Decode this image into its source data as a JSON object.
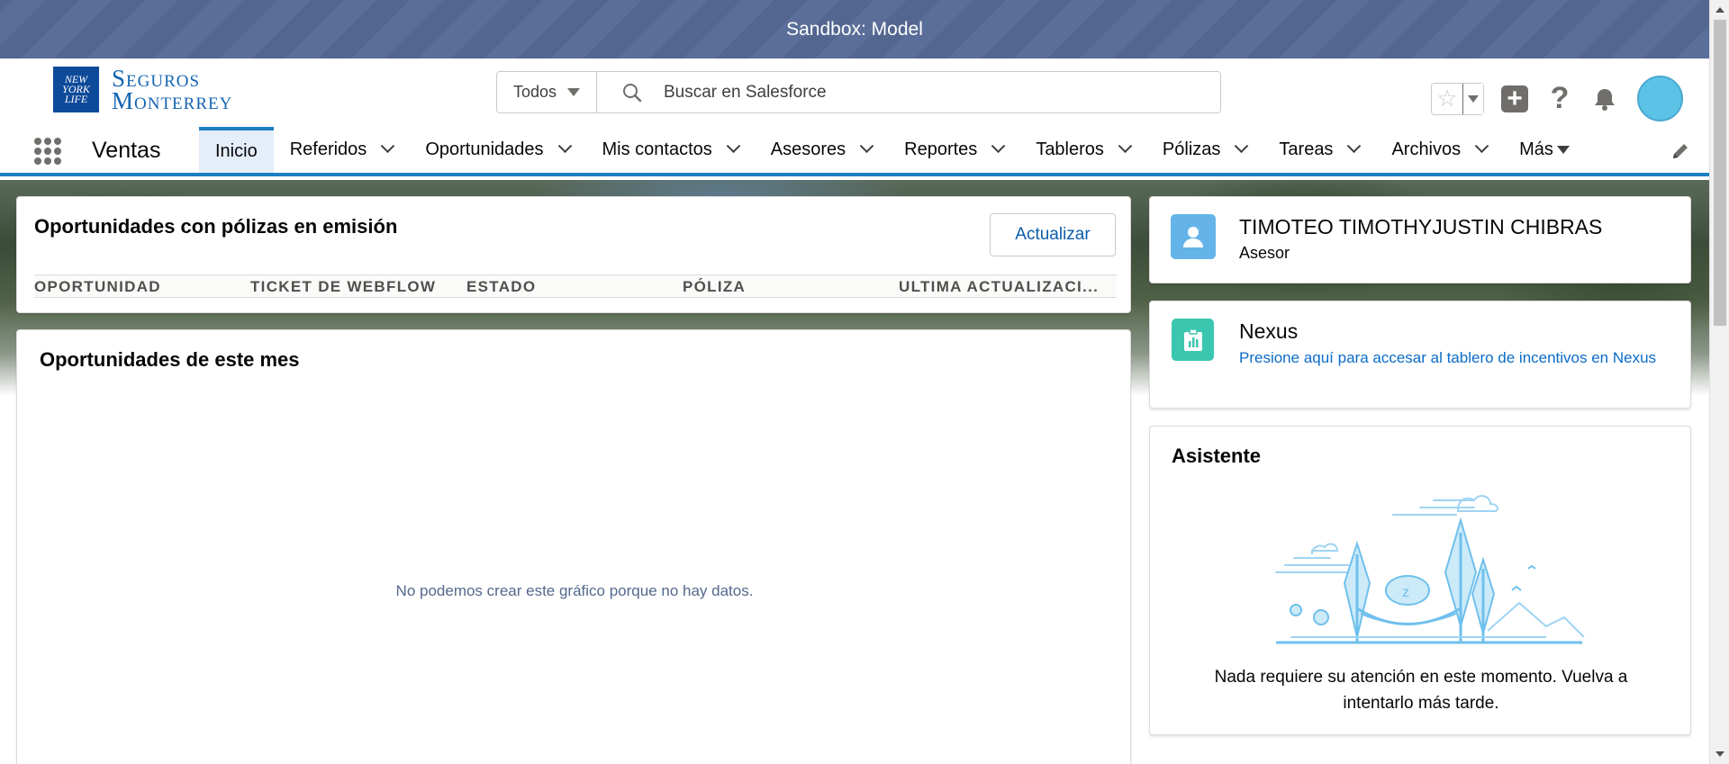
{
  "sandbox_banner": "Sandbox: Model",
  "logo": {
    "badge_lines": [
      "NEW",
      "YORK",
      "LIFE"
    ],
    "name_line1": "Seguros",
    "name_line2": "Monterrey"
  },
  "search": {
    "scope": "Todos",
    "placeholder": "Buscar en Salesforce"
  },
  "nav": {
    "app_name": "Ventas",
    "tabs": [
      {
        "label": "Inicio",
        "active": true
      },
      {
        "label": "Referidos"
      },
      {
        "label": "Oportunidades"
      },
      {
        "label": "Mis contactos"
      },
      {
        "label": "Asesores"
      },
      {
        "label": "Reportes"
      },
      {
        "label": "Tableros"
      },
      {
        "label": "Pólizas"
      },
      {
        "label": "Tareas"
      },
      {
        "label": "Archivos"
      }
    ],
    "more": "Más"
  },
  "opp_emision": {
    "title": "Oportunidades con pólizas en emisión",
    "refresh_label": "Actualizar",
    "columns": [
      "OPORTUNIDAD",
      "TICKET DE WEBFLOW",
      "ESTADO",
      "PÓLIZA",
      "ULTIMA ACTUALIZACI..."
    ]
  },
  "opp_mes": {
    "title": "Oportunidades de este mes",
    "empty_message": "No podemos crear este gráfico porque no hay datos."
  },
  "user_card": {
    "name": "TIMOTEO TIMOTHYJUSTIN CHIBRAS",
    "role": "Asesor"
  },
  "nexus": {
    "title": "Nexus",
    "link_text": "Presione aquí para accesar al tablero de incentivos en Nexus"
  },
  "asistente": {
    "title": "Asistente",
    "illustration_text": "z",
    "message": "Nada requiere su atención en este momento. Vuelva a intentarlo más tarde."
  },
  "colors": {
    "brand_blue": "#1b7ec2",
    "link": "#0b6cc8",
    "sandbox_bar": "#5a6e99"
  }
}
